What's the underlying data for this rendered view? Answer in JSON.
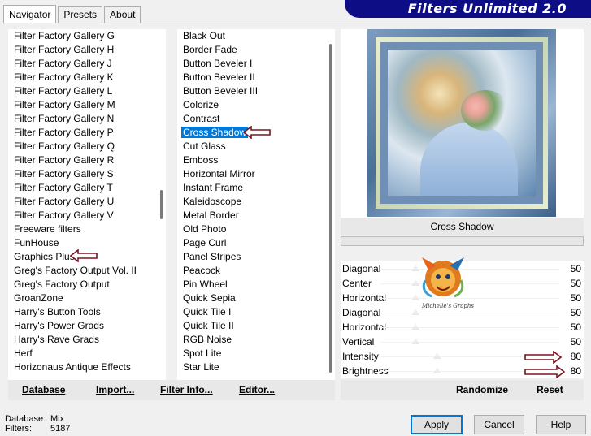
{
  "banner": {
    "title": "Filters Unlimited 2.0"
  },
  "tabs": [
    {
      "label": "Navigator",
      "active": true
    },
    {
      "label": "Presets",
      "active": false
    },
    {
      "label": "About",
      "active": false
    }
  ],
  "categories": [
    "Filter Factory Gallery G",
    "Filter Factory Gallery H",
    "Filter Factory Gallery J",
    "Filter Factory Gallery K",
    "Filter Factory Gallery L",
    "Filter Factory Gallery M",
    "Filter Factory Gallery N",
    "Filter Factory Gallery P",
    "Filter Factory Gallery Q",
    "Filter Factory Gallery R",
    "Filter Factory Gallery S",
    "Filter Factory Gallery T",
    "Filter Factory Gallery U",
    "Filter Factory Gallery V",
    "Freeware filters",
    "FunHouse",
    "Graphics Plus",
    "Greg's Factory Output Vol. II",
    "Greg's Factory Output",
    "GroanZone",
    "Harry's Button Tools",
    "Harry's Power Grads",
    "Harry's Rave Grads",
    "Herf",
    "Horizonaus Antique Effects"
  ],
  "filters": [
    "Black Out",
    "Border Fade",
    "Button Beveler I",
    "Button Beveler II",
    "Button Beveler III",
    "Colorize",
    "Contrast",
    "Cross Shadow",
    "Cut Glass",
    "Emboss",
    "Horizontal Mirror",
    "Instant Frame",
    "Kaleidoscope",
    "Metal Border",
    "Old Photo",
    "Page Curl",
    "Panel Stripes",
    "Peacock",
    "Pin Wheel",
    "Quick Sepia",
    "Quick Tile I",
    "Quick Tile II",
    "RGB Noise",
    "Spot Lite",
    "Star Lite"
  ],
  "selected_filter": "Cross Shadow",
  "toolbar_left": {
    "database": "Database",
    "import": "Import...",
    "filter_info": "Filter Info...",
    "editor": "Editor..."
  },
  "effect_name": "Cross Shadow",
  "sliders": [
    {
      "label": "Diagonal",
      "value": "50",
      "level": 0.2
    },
    {
      "label": "Center",
      "value": "50",
      "level": 0.2
    },
    {
      "label": "Horizontal",
      "value": "50",
      "level": 0.2
    },
    {
      "label": "Diagonal",
      "value": "50",
      "level": 0.2
    },
    {
      "label": "Horizontal",
      "value": "50",
      "level": 0.2
    },
    {
      "label": "Vertical",
      "value": "50",
      "level": 0.2
    },
    {
      "label": "Intensity",
      "value": "80",
      "level": 0.32
    },
    {
      "label": "Brightness",
      "value": "80",
      "level": 0.32
    }
  ],
  "logo_text": "Michelle's Graphs",
  "toolbar_right": {
    "randomize": "Randomize",
    "reset": "Reset"
  },
  "status": {
    "database_label": "Database:",
    "database_value": "Mix",
    "filters_label": "Filters:",
    "filters_value": "5187"
  },
  "buttons": {
    "apply": "Apply",
    "cancel": "Cancel",
    "help": "Help"
  },
  "colors": {
    "banner": "#0d0d86",
    "selection": "#0078d7",
    "arrow": "#7a1420"
  }
}
